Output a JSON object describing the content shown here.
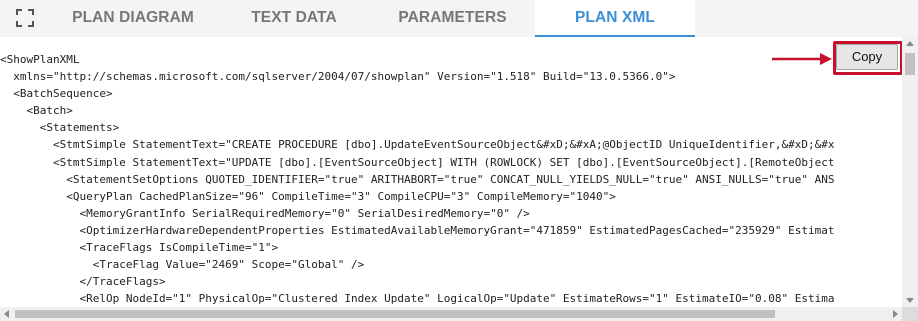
{
  "tabs": [
    {
      "label": "PLAN DIAGRAM",
      "active": false
    },
    {
      "label": "TEXT DATA",
      "active": false
    },
    {
      "label": "PARAMETERS",
      "active": false
    },
    {
      "label": "PLAN XML",
      "active": true
    }
  ],
  "toolbar": {
    "expand_icon": "expand-icon",
    "copy_label": "Copy"
  },
  "colors": {
    "accent": "#3b8fd6",
    "callout": "#c8102e",
    "tab_text": "#777777",
    "tabbar_bg": "#f4f4f4"
  },
  "xml_lines": [
    "<ShowPlanXML",
    "  xmlns=\"http://schemas.microsoft.com/sqlserver/2004/07/showplan\" Version=\"1.518\" Build=\"13.0.5366.0\">",
    "  <BatchSequence>",
    "    <Batch>",
    "      <Statements>",
    "        <StmtSimple StatementText=\"CREATE PROCEDURE [dbo].UpdateEventSourceObject&#xD;&#xA;@ObjectID UniqueIdentifier,&#xD;&#x",
    "        <StmtSimple StatementText=\"UPDATE [dbo].[EventSourceObject] WITH (ROWLOCK) SET [dbo].[EventSourceObject].[RemoteObject",
    "          <StatementSetOptions QUOTED_IDENTIFIER=\"true\" ARITHABORT=\"true\" CONCAT_NULL_YIELDS_NULL=\"true\" ANSI_NULLS=\"true\" ANS",
    "          <QueryPlan CachedPlanSize=\"96\" CompileTime=\"3\" CompileCPU=\"3\" CompileMemory=\"1040\">",
    "            <MemoryGrantInfo SerialRequiredMemory=\"0\" SerialDesiredMemory=\"0\" />",
    "            <OptimizerHardwareDependentProperties EstimatedAvailableMemoryGrant=\"471859\" EstimatedPagesCached=\"235929\" Estimat",
    "            <TraceFlags IsCompileTime=\"1\">",
    "              <TraceFlag Value=\"2469\" Scope=\"Global\" />",
    "            </TraceFlags>",
    "            <RelOp NodeId=\"1\" PhysicalOp=\"Clustered Index Update\" LogicalOp=\"Update\" EstimateRows=\"1\" EstimateIO=\"0.08\" Estima"
  ]
}
